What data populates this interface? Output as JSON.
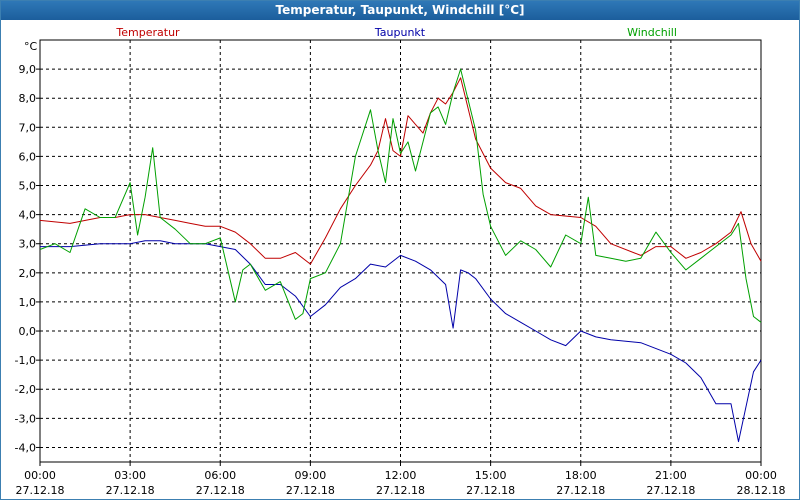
{
  "window": {
    "title": "Temperatur, Taupunkt, Windchill [°C]"
  },
  "chart_data": {
    "type": "line",
    "ylabel": "°C",
    "ylim": [
      -4.5,
      10.0
    ],
    "xlim": [
      "27.12.18 00:00",
      "28.12.18 00:00"
    ],
    "x_ticks": [
      {
        "time": "00:00",
        "date": "27.12.18"
      },
      {
        "time": "03:00",
        "date": "27.12.18"
      },
      {
        "time": "06:00",
        "date": "27.12.18"
      },
      {
        "time": "09:00",
        "date": "27.12.18"
      },
      {
        "time": "12:00",
        "date": "27.12.18"
      },
      {
        "time": "15:00",
        "date": "27.12.18"
      },
      {
        "time": "18:00",
        "date": "27.12.18"
      },
      {
        "time": "21:00",
        "date": "27.12.18"
      },
      {
        "time": "00:00",
        "date": "28.12.18"
      }
    ],
    "y_ticks": [
      {
        "v": 9,
        "label": "9,0"
      },
      {
        "v": 8,
        "label": "8,0"
      },
      {
        "v": 7,
        "label": "7,0"
      },
      {
        "v": 6,
        "label": "6,0"
      },
      {
        "v": 5,
        "label": "5,0"
      },
      {
        "v": 4,
        "label": "4,0"
      },
      {
        "v": 3,
        "label": "3,0"
      },
      {
        "v": 2,
        "label": "2,0"
      },
      {
        "v": 1,
        "label": "1,0"
      },
      {
        "v": 0,
        "label": "0,0"
      },
      {
        "v": -1,
        "label": "-1,0"
      },
      {
        "v": -2,
        "label": "-2,0"
      },
      {
        "v": -3,
        "label": "-3,0"
      },
      {
        "v": -4,
        "label": "-4,0"
      }
    ],
    "grid": true,
    "legend_placement": "top",
    "series": [
      {
        "name": "Temperatur",
        "color": "#c00000",
        "x": [
          "00:00",
          "01:00",
          "02:00",
          "02:30",
          "03:00",
          "03:30",
          "04:00",
          "04:30",
          "05:00",
          "05:30",
          "06:00",
          "06:30",
          "07:00",
          "07:30",
          "08:00",
          "08:30",
          "09:00",
          "09:30",
          "10:00",
          "10:30",
          "11:00",
          "11:15",
          "11:30",
          "11:45",
          "12:00",
          "12:15",
          "12:30",
          "12:45",
          "13:00",
          "13:15",
          "13:30",
          "13:45",
          "14:00",
          "14:30",
          "15:00",
          "15:30",
          "16:00",
          "16:30",
          "17:00",
          "18:00",
          "18:30",
          "19:00",
          "20:00",
          "20:30",
          "21:00",
          "21:30",
          "22:00",
          "22:30",
          "23:00",
          "23:20",
          "23:40",
          "24:00"
        ],
        "values": [
          3.8,
          3.7,
          3.9,
          3.9,
          4.0,
          4.0,
          3.9,
          3.8,
          3.7,
          3.6,
          3.6,
          3.4,
          3.0,
          2.5,
          2.5,
          2.7,
          2.3,
          3.2,
          4.2,
          5.0,
          5.7,
          6.2,
          7.3,
          6.2,
          6.0,
          7.4,
          7.1,
          6.8,
          7.5,
          8.0,
          7.8,
          8.2,
          8.7,
          6.6,
          5.6,
          5.1,
          4.9,
          4.3,
          4.0,
          3.9,
          3.6,
          3.0,
          2.6,
          2.9,
          2.9,
          2.5,
          2.7,
          3.0,
          3.4,
          4.1,
          3.0,
          2.4
        ]
      },
      {
        "name": "Taupunkt",
        "color": "#0000a8",
        "x": [
          "00:00",
          "01:00",
          "02:00",
          "03:00",
          "03:30",
          "04:00",
          "04:30",
          "05:00",
          "05:30",
          "06:00",
          "06:30",
          "07:00",
          "07:30",
          "08:00",
          "08:30",
          "09:00",
          "09:30",
          "10:00",
          "10:30",
          "11:00",
          "11:30",
          "12:00",
          "12:30",
          "13:00",
          "13:30",
          "13:45",
          "14:00",
          "14:15",
          "14:30",
          "15:00",
          "15:30",
          "16:00",
          "16:30",
          "17:00",
          "17:30",
          "18:00",
          "18:30",
          "19:00",
          "20:00",
          "21:00",
          "21:30",
          "22:00",
          "22:30",
          "23:00",
          "23:15",
          "23:30",
          "23:45",
          "24:00"
        ],
        "values": [
          2.9,
          2.9,
          3.0,
          3.0,
          3.1,
          3.1,
          3.0,
          3.0,
          3.0,
          2.9,
          2.8,
          2.3,
          1.6,
          1.6,
          1.2,
          0.5,
          0.9,
          1.5,
          1.8,
          2.3,
          2.2,
          2.6,
          2.4,
          2.1,
          1.6,
          0.1,
          2.1,
          2.0,
          1.8,
          1.1,
          0.6,
          0.3,
          0.0,
          -0.3,
          -0.5,
          0.0,
          -0.2,
          -0.3,
          -0.4,
          -0.8,
          -1.1,
          -1.6,
          -2.5,
          -2.5,
          -3.8,
          -2.6,
          -1.4,
          -1.0
        ]
      },
      {
        "name": "Windchill",
        "color": "#00a000",
        "x": [
          "00:00",
          "00:30",
          "01:00",
          "01:30",
          "02:00",
          "02:30",
          "03:00",
          "03:15",
          "03:30",
          "03:45",
          "04:00",
          "04:30",
          "05:00",
          "05:30",
          "06:00",
          "06:30",
          "06:45",
          "07:00",
          "07:30",
          "08:00",
          "08:30",
          "08:45",
          "09:00",
          "09:30",
          "10:00",
          "10:30",
          "11:00",
          "11:15",
          "11:30",
          "11:45",
          "12:00",
          "12:15",
          "12:30",
          "13:00",
          "13:15",
          "13:30",
          "13:45",
          "14:00",
          "14:30",
          "14:45",
          "15:00",
          "15:30",
          "16:00",
          "16:30",
          "17:00",
          "17:30",
          "18:00",
          "18:15",
          "18:30",
          "19:00",
          "19:30",
          "20:00",
          "20:30",
          "21:00",
          "21:30",
          "22:00",
          "22:30",
          "23:00",
          "23:15",
          "23:30",
          "23:45",
          "24:00"
        ],
        "values": [
          2.8,
          3.0,
          2.7,
          4.2,
          3.9,
          3.9,
          5.1,
          3.3,
          4.6,
          6.3,
          3.9,
          3.5,
          3.0,
          3.0,
          3.2,
          1.0,
          2.1,
          2.3,
          1.4,
          1.7,
          0.4,
          0.6,
          1.8,
          2.0,
          3.0,
          6.0,
          7.6,
          6.2,
          5.1,
          7.3,
          6.1,
          6.5,
          5.5,
          7.5,
          7.7,
          7.1,
          8.2,
          9.0,
          6.9,
          4.7,
          3.6,
          2.6,
          3.1,
          2.8,
          2.2,
          3.3,
          3.0,
          4.6,
          2.6,
          2.5,
          2.4,
          2.5,
          3.4,
          2.7,
          2.1,
          2.5,
          2.9,
          3.3,
          3.7,
          1.8,
          0.5,
          0.3
        ]
      }
    ]
  }
}
